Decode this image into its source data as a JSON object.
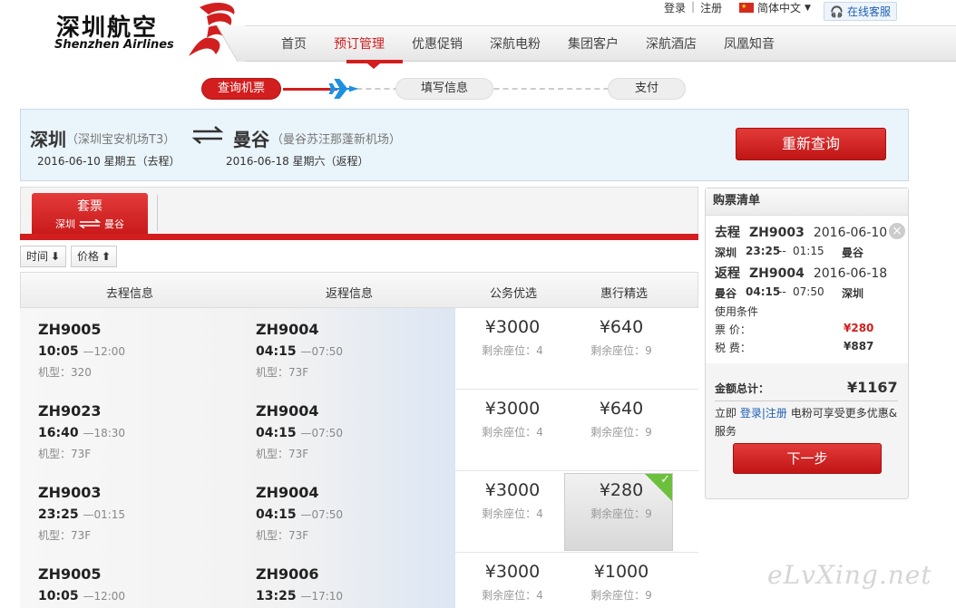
{
  "header": {
    "login": "登录",
    "register": "注册",
    "language": "简体中文",
    "online_service": "在线客服",
    "logo_cn": "深圳航空",
    "logo_en": "Shenzhen Airlines"
  },
  "nav": {
    "items": [
      "首页",
      "预订管理",
      "优惠促销",
      "深航电粉",
      "集团客户",
      "深航酒店",
      "凤凰知音"
    ],
    "active": "预订管理"
  },
  "steps": [
    "查询机票",
    "填写信息",
    "支付"
  ],
  "search": {
    "from_city": "深圳",
    "from_airport": "（深圳宝安机场T3）",
    "to_city": "曼谷",
    "to_airport": "（曼谷苏汪那蓬新机场）",
    "depart_date": "2016-06-10 星期五（去程）",
    "return_date": "2016-06-18 星期六（返程）",
    "requery_label": "重新查询"
  },
  "tab": {
    "title": "套票",
    "from": "深圳",
    "to": "曼谷"
  },
  "sort": {
    "time": "时间",
    "price": "价格"
  },
  "table": {
    "headers": [
      "去程信息",
      "返程信息",
      "公务优选",
      "惠行精选"
    ],
    "seat_prefix": "剩余座位：",
    "rows": [
      {
        "out": {
          "no": "ZH9005",
          "dep": "10:05",
          "arr": "—12:00",
          "model": "机型：320"
        },
        "ret": {
          "no": "ZH9004",
          "dep": "04:15",
          "arr": "—07:50",
          "model": "机型：73F"
        },
        "biz": {
          "price": "¥3000",
          "seats": "剩余座位：4"
        },
        "eco": {
          "price": "¥640",
          "seats": "剩余座位：9"
        }
      },
      {
        "out": {
          "no": "ZH9023",
          "dep": "16:40",
          "arr": "—18:30",
          "model": "机型：73F"
        },
        "ret": {
          "no": "ZH9004",
          "dep": "04:15",
          "arr": "—07:50",
          "model": "机型：73F"
        },
        "biz": {
          "price": "¥3000",
          "seats": "剩余座位：4"
        },
        "eco": {
          "price": "¥640",
          "seats": "剩余座位：9"
        }
      },
      {
        "out": {
          "no": "ZH9003",
          "dep": "23:25",
          "arr": "—01:15",
          "model": "机型：73F"
        },
        "ret": {
          "no": "ZH9004",
          "dep": "04:15",
          "arr": "—07:50",
          "model": "机型：73F"
        },
        "biz": {
          "price": "¥3000",
          "seats": "剩余座位：4"
        },
        "eco": {
          "price": "¥280",
          "seats": "剩余座位：9"
        }
      },
      {
        "out": {
          "no": "ZH9005",
          "dep": "10:05",
          "arr": "—12:00",
          "model": ""
        },
        "ret": {
          "no": "ZH9006",
          "dep": "13:25",
          "arr": "—17:10",
          "model": ""
        },
        "biz": {
          "price": "¥3000",
          "seats": "剩余座位：4"
        },
        "eco": {
          "price": "¥1000",
          "seats": "剩余座位：9"
        }
      }
    ]
  },
  "cart": {
    "title": "购票清单",
    "out": {
      "label": "去程",
      "no": "ZH9003",
      "date": "2016-06-10",
      "from": "深圳",
      "dep": "23:25",
      "sep": "--",
      "arr": "01:15",
      "to": "曼谷"
    },
    "ret": {
      "label": "返程",
      "no": "ZH9004",
      "date": "2016-06-18",
      "from": "曼谷",
      "dep": "04:15",
      "sep": "--",
      "arr": "07:50",
      "to": "深圳"
    },
    "conditions": "使用条件",
    "fare_label": "票  价：",
    "fare": "¥280",
    "tax_label": "税  费：",
    "tax": "¥887",
    "total_label": "金额总计：",
    "total": "¥1167",
    "note_pre": "立即",
    "note_link": "登录|注册",
    "note_post": "电粉可享受更多优惠&服务",
    "next_label": "下一步"
  },
  "watermark": "eLvXing.net",
  "colors": {
    "brand_red": "#d21e1e",
    "link_blue": "#1f5fb3",
    "check_green": "#6cc03b"
  }
}
